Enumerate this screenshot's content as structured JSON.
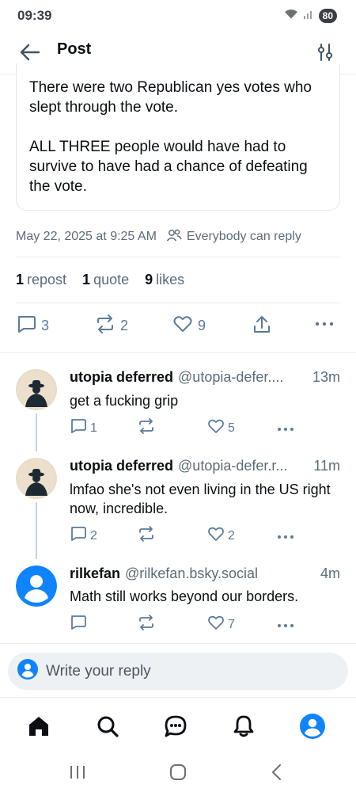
{
  "status": {
    "time": "09:39",
    "battery": "80"
  },
  "header": {
    "title": "Post"
  },
  "post": {
    "text": "There were two Republican yes votes who slept through the vote.\n\nALL THREE people would have had to survive to have had a chance of defeating the vote.",
    "timestamp": "May 22, 2025 at 9:25 AM",
    "reply_setting": "Everybody can reply",
    "reposts_count": "1",
    "reposts_label": "repost",
    "quotes_count": "1",
    "quotes_label": "quote",
    "likes_count": "9",
    "likes_label": "likes",
    "reply_count": "3",
    "repost_count_action": "2",
    "like_count_action": "9"
  },
  "replies": [
    {
      "name": "utopia deferred",
      "handle": "@utopia-defer....",
      "time": "13m",
      "text": "get a fucking grip",
      "replies": "1",
      "reposts": "",
      "likes": "5"
    },
    {
      "name": "utopia deferred",
      "handle": "@utopia-defer.r...",
      "time": "11m",
      "text": "lmfao she's not even living in the US right now, incredible.",
      "replies": "2",
      "reposts": "",
      "likes": "2"
    },
    {
      "name": "rilkefan",
      "handle": "@rilkefan.bsky.social",
      "time": "4m",
      "text": "Math still works beyond our borders.",
      "replies": "",
      "reposts": "",
      "likes": "7"
    }
  ],
  "composer": {
    "placeholder": "Write your reply"
  },
  "nav": [
    "home-icon",
    "search-icon",
    "chat-icon",
    "bell-icon",
    "profile-icon"
  ],
  "colors": {
    "accent": "#1083fe",
    "muted": "#5c6b7a",
    "icon": "#5c7a9a"
  }
}
